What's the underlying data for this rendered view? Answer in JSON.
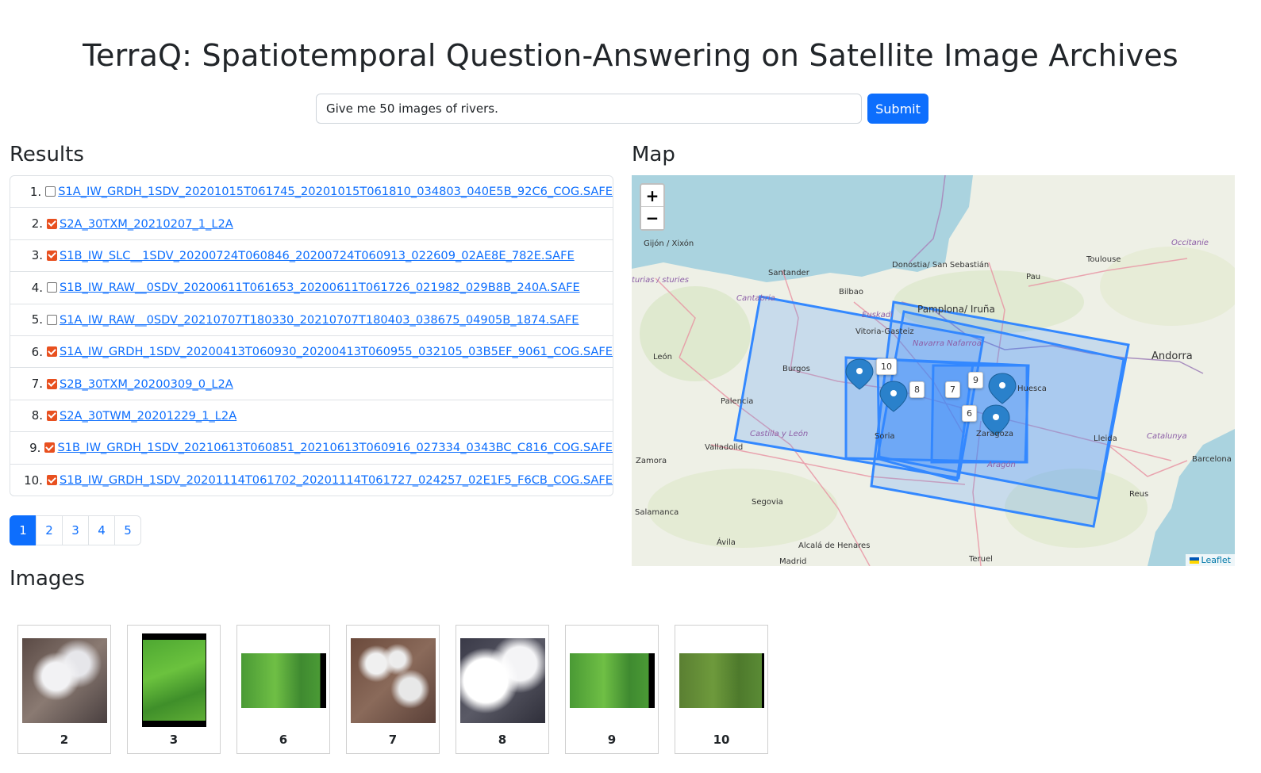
{
  "title": "TerraQ: Spatiotemporal Question-Answering on Satellite Image Archives",
  "search": {
    "value": "Give me 50 images of rivers.",
    "submit_label": "Submit"
  },
  "results": {
    "heading": "Results",
    "items": [
      {
        "num": "1.",
        "checked": false,
        "name": "S1A_IW_GRDH_1SDV_20201015T061745_20201015T061810_034803_040E5B_92C6_COG.SAFE"
      },
      {
        "num": "2.",
        "checked": true,
        "name": "S2A_30TXM_20210207_1_L2A"
      },
      {
        "num": "3.",
        "checked": true,
        "name": "S1B_IW_SLC__1SDV_20200724T060846_20200724T060913_022609_02AE8E_782E.SAFE"
      },
      {
        "num": "4.",
        "checked": false,
        "name": "S1B_IW_RAW__0SDV_20200611T061653_20200611T061726_021982_029B8B_240A.SAFE"
      },
      {
        "num": "5.",
        "checked": false,
        "name": "S1A_IW_RAW__0SDV_20210707T180330_20210707T180403_038675_04905B_1874.SAFE"
      },
      {
        "num": "6.",
        "checked": true,
        "name": "S1A_IW_GRDH_1SDV_20200413T060930_20200413T060955_032105_03B5EF_9061_COG.SAFE"
      },
      {
        "num": "7.",
        "checked": true,
        "name": "S2B_30TXM_20200309_0_L2A"
      },
      {
        "num": "8.",
        "checked": true,
        "name": "S2A_30TWM_20201229_1_L2A"
      },
      {
        "num": "9.",
        "checked": true,
        "name": "S1B_IW_GRDH_1SDV_20210613T060851_20210613T060916_027334_0343BC_C816_COG.SAFE"
      },
      {
        "num": "10.",
        "checked": true,
        "name": "S1B_IW_GRDH_1SDV_20201114T061702_20201114T061727_024257_02E1F5_F6CB_COG.SAFE"
      }
    ]
  },
  "pagination": {
    "pages": [
      "1",
      "2",
      "3",
      "4",
      "5"
    ],
    "active": "1"
  },
  "map": {
    "heading": "Map",
    "zoom_in": "+",
    "zoom_out": "−",
    "attribution": "Leaflet",
    "places": [
      "Gijón / Xixón",
      "Santander",
      "Bilbao",
      "Donostia/ San Sebastián",
      "Toulouse",
      "Pau",
      "Occitanie",
      "Cantabria",
      "Euskadi",
      "Vitoria-Gasteiz",
      "Pamplona/ Iruña",
      "Navarra Nafarroa",
      "León",
      "Burgos",
      "Palencia",
      "Huesca",
      "Andorra",
      "Zaragoza",
      "Castilla y León",
      "Valladolid",
      "Soria",
      "Lleida",
      "Catalunya",
      "Zamora",
      "Aragón",
      "Barcelona",
      "Segovia",
      "Reus",
      "Salamanca",
      "Ávila",
      "Alcalá de Henares",
      "Madrid",
      "Teruel",
      "turias / sturies"
    ],
    "markers": [
      "10",
      "8",
      "7",
      "9",
      "6"
    ],
    "colors": {
      "water": "#aad3df",
      "land": "#eef0e6",
      "footprint": "#3388ff"
    }
  },
  "images": {
    "heading": "Images",
    "items": [
      {
        "label": "2",
        "style": "cloudy"
      },
      {
        "label": "3",
        "style": "green-tall"
      },
      {
        "label": "6",
        "style": "green-wide"
      },
      {
        "label": "7",
        "style": "snowy"
      },
      {
        "label": "8",
        "style": "cloudy-white"
      },
      {
        "label": "9",
        "style": "green-wide"
      },
      {
        "label": "10",
        "style": "green-olive"
      }
    ]
  }
}
